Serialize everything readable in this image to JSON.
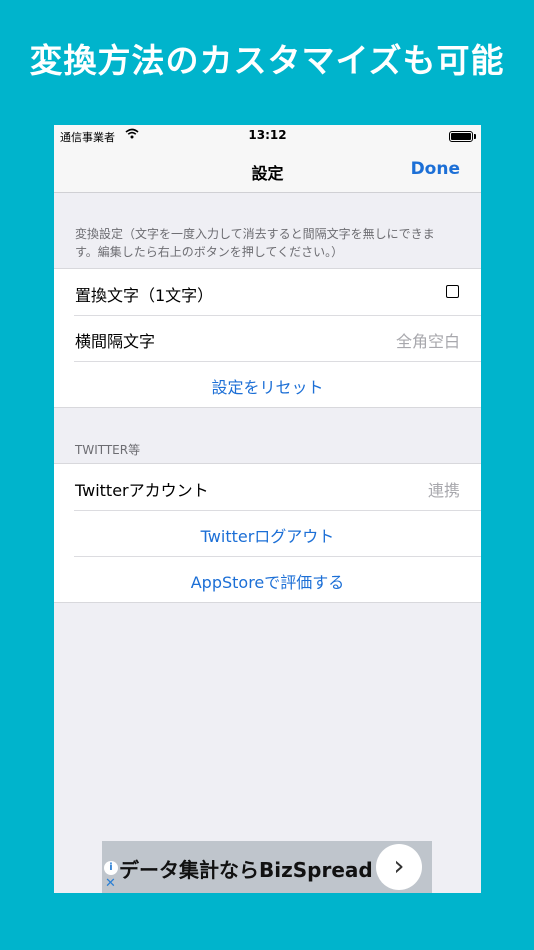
{
  "headline": "変換方法のカスタマイズも可能",
  "status_bar": {
    "carrier": "通信事業者",
    "wifi_icon": "wifi-icon",
    "time": "13:12",
    "battery_icon": "battery-icon"
  },
  "nav": {
    "title": "設定",
    "done_label": "Done"
  },
  "section1": {
    "header_line1": "変換設定（文字を一度入力して消去すると間隔文字を無しにできま",
    "header_line2": "す。編集したら右上のボタンを押してください。）",
    "rows": [
      {
        "label": "置換文字（1文字）",
        "value": ""
      },
      {
        "label": "横間隔文字",
        "value": "全角空白"
      }
    ],
    "reset_label": "設定をリセット"
  },
  "section2": {
    "header": "TWITTER等",
    "account_label": "Twitterアカウント",
    "account_value": "連携",
    "logout_label": "Twitterログアウト",
    "rate_label": "AppStoreで評価する"
  },
  "ad": {
    "text": "データ集計ならBizSpread",
    "info_icon": "info-icon",
    "close_icon": "close-icon",
    "arrow_icon": "chevron-right-icon"
  },
  "colors": {
    "background": "#00b4cc",
    "accent": "#1c6fd6",
    "table_bg": "#efeff4"
  }
}
